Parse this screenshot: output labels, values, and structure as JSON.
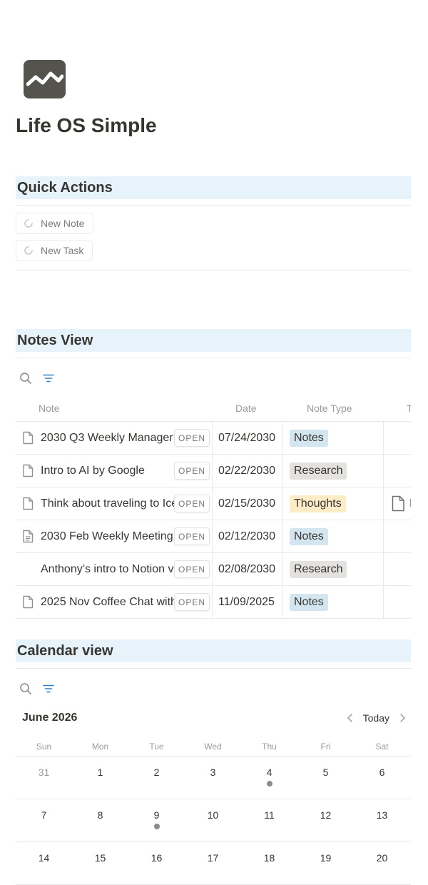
{
  "page": {
    "title": "Life OS Simple",
    "icon": "trend-chart-icon"
  },
  "quick_actions": {
    "title": "Quick Actions",
    "buttons": [
      {
        "label": "New Note",
        "icon": "loading-spinner-icon"
      },
      {
        "label": "New Task",
        "icon": "loading-spinner-icon"
      }
    ]
  },
  "notes_view": {
    "title": "Notes View",
    "toolbar": {
      "search_icon": "search-icon",
      "filter_icon": "filter-icon"
    },
    "columns": {
      "note": "Note",
      "date": "Date",
      "type": "Note Type",
      "extra": "T"
    },
    "open_label": "OPEN",
    "rows": [
      {
        "note": "2030 Q3 Weekly Manager",
        "date": "07/24/2030",
        "type": "Notes",
        "type_color": "#d3e5ef",
        "icon": "page-icon"
      },
      {
        "note": "Intro to AI by Google",
        "date": "02/22/2030",
        "type": "Research",
        "type_color": "#e3e2e0",
        "icon": "page-icon"
      },
      {
        "note": "Think about traveling to Ice",
        "date": "02/15/2030",
        "type": "Thoughts",
        "type_color": "#fdecc8",
        "icon": "page-icon",
        "extra": "I"
      },
      {
        "note": "2030 Feb Weekly Meeting",
        "date": "02/12/2030",
        "type": "Notes",
        "type_color": "#d3e5ef",
        "icon": "page-text-icon"
      },
      {
        "note": "Anthony’s intro to Notion vi",
        "date": "02/08/2030",
        "type": "Research",
        "type_color": "#e3e2e0",
        "icon": ""
      },
      {
        "note": "2025 Nov Coffee Chat with",
        "date": "11/09/2025",
        "type": "Notes",
        "type_color": "#d3e5ef",
        "icon": "page-icon"
      }
    ]
  },
  "calendar_view": {
    "title": "Calendar view",
    "toolbar": {
      "search_icon": "search-icon",
      "filter_icon": "filter-icon"
    },
    "month": "June 2026",
    "today_label": "Today",
    "days_of_week": [
      "Sun",
      "Mon",
      "Tue",
      "Wed",
      "Thu",
      "Fri",
      "Sat"
    ],
    "weeks": [
      [
        {
          "n": "31",
          "muted": true
        },
        {
          "n": "1"
        },
        {
          "n": "2"
        },
        {
          "n": "3"
        },
        {
          "n": "4",
          "dot": true
        },
        {
          "n": "5"
        },
        {
          "n": "6"
        }
      ],
      [
        {
          "n": "7"
        },
        {
          "n": "8"
        },
        {
          "n": "9",
          "dot": true
        },
        {
          "n": "10"
        },
        {
          "n": "11"
        },
        {
          "n": "12"
        },
        {
          "n": "13"
        }
      ],
      [
        {
          "n": "14"
        },
        {
          "n": "15"
        },
        {
          "n": "16"
        },
        {
          "n": "17"
        },
        {
          "n": "18"
        },
        {
          "n": "19"
        },
        {
          "n": "20"
        }
      ]
    ]
  }
}
